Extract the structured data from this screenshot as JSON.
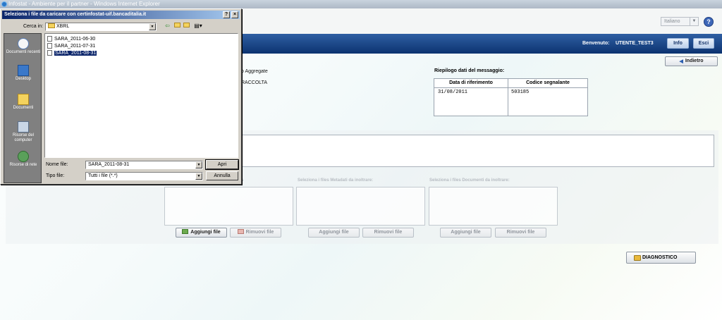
{
  "browser": {
    "title": "Infostat - Ambiente per il partner - Windows Internet Explorer"
  },
  "header": {
    "language": "Italiano",
    "help": "?"
  },
  "navbar": {
    "welcome_label": "Benvenuto:",
    "user": "UTENTE_TEST3",
    "info_label": "Info",
    "exit_label": "Esci"
  },
  "page": {
    "back_label": "Indietro",
    "partial_text_1": "o Aggregate",
    "partial_text_2": "RACCOLTA",
    "summary": {
      "title": "Riepilogo dati del messaggio:",
      "columns": [
        "Data di riferimento",
        "Codice segnalante"
      ],
      "values": [
        "31/08/2011",
        "503185"
      ]
    },
    "upload": {
      "labels": [
        "s",
        "Seleziona i files Metadati da inoltrare:",
        "Seleziona i files Documenti da inoltrare:"
      ],
      "add_label": "Aggiungi file",
      "remove_label": "Rimuovi file"
    },
    "diagnostic_label": "DIAGNOSTICO"
  },
  "dialog": {
    "title": "Seleziona i file da caricare con certinfostat-uif.bancaditalia.it",
    "look_in_label": "Cerca in:",
    "look_in_value": "XBRL",
    "places": [
      "Documenti recenti",
      "Desktop",
      "Documenti",
      "Risorse del computer",
      "Risorse di rete"
    ],
    "files": [
      "SARA_2011-06-30",
      "SARA_2011-07-31",
      "SARA_2011-08-31"
    ],
    "selected_file": "SARA_2011-08-31",
    "filename_label": "Nome file:",
    "filename_value": "SARA_2011-08-31",
    "filetype_label": "Tipo file:",
    "filetype_value": "Tutti i file (*.*)",
    "open_label": "Apri",
    "cancel_label": "Annulla"
  }
}
